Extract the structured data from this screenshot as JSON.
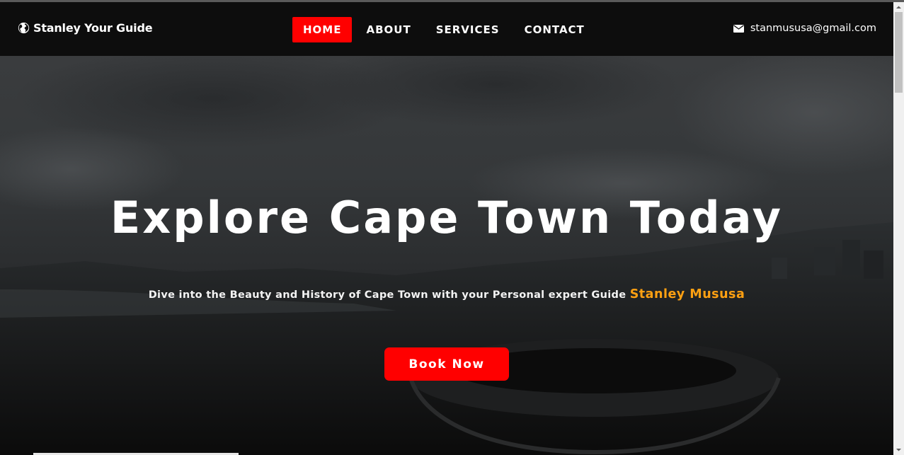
{
  "brand": {
    "name": "Stanley Your Guide",
    "icon": "globe-icon"
  },
  "nav": {
    "items": [
      {
        "label": "HOME",
        "active": true
      },
      {
        "label": "ABOUT",
        "active": false
      },
      {
        "label": "SERVICES",
        "active": false
      },
      {
        "label": "CONTACT",
        "active": false
      }
    ]
  },
  "contact": {
    "email": "stanmususa@gmail.com",
    "icon": "envelope-icon"
  },
  "hero": {
    "title": "Explore Cape Town Today",
    "subtitle": "Dive into the Beauty and History of Cape Town with your Personal expert Guide",
    "highlight": "Stanley Mususa",
    "cta_label": "Book Now"
  },
  "colors": {
    "accent": "#ff0000",
    "highlight": "#ffa012",
    "navbar_bg": "#0d0d0d"
  }
}
